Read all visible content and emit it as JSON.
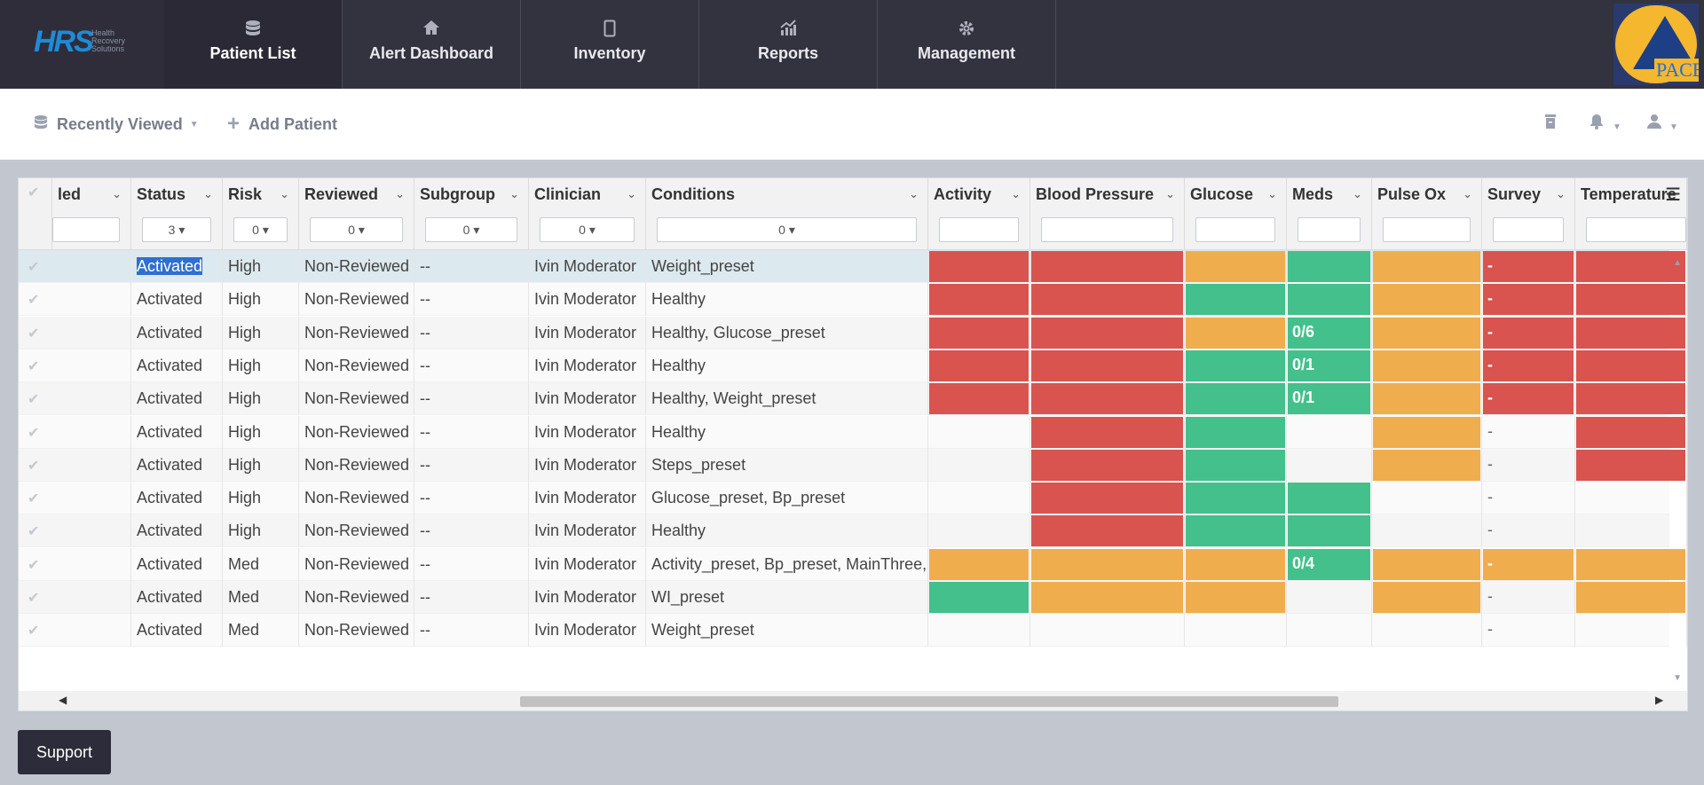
{
  "brand": {
    "logo_text": "HRS",
    "logo_sub": "Health Recovery Solutions",
    "corner_logo_text": "PACE"
  },
  "nav": [
    {
      "label": "Patient List",
      "icon": "database-icon",
      "active": true
    },
    {
      "label": "Alert Dashboard",
      "icon": "home-icon",
      "active": false
    },
    {
      "label": "Inventory",
      "icon": "tablet-icon",
      "active": false
    },
    {
      "label": "Reports",
      "icon": "chart-icon",
      "active": false
    },
    {
      "label": "Management",
      "icon": "gear-icon",
      "active": false
    }
  ],
  "toolbar": {
    "recently_viewed": "Recently Viewed",
    "add_patient": "Add Patient"
  },
  "grid": {
    "columns": [
      {
        "label": "led",
        "filter": ""
      },
      {
        "label": "Status",
        "filter": "3"
      },
      {
        "label": "Risk",
        "filter": "0"
      },
      {
        "label": "Reviewed",
        "filter": "0"
      },
      {
        "label": "Subgroup",
        "filter": "0"
      },
      {
        "label": "Clinician",
        "filter": "0"
      },
      {
        "label": "Conditions",
        "filter": "0"
      },
      {
        "label": "Activity",
        "filter": ""
      },
      {
        "label": "Blood Pressure",
        "filter": ""
      },
      {
        "label": "Glucose",
        "filter": ""
      },
      {
        "label": "Meds",
        "filter": ""
      },
      {
        "label": "Pulse Ox",
        "filter": ""
      },
      {
        "label": "Survey",
        "filter": ""
      },
      {
        "label": "Temperature",
        "filter": ""
      }
    ],
    "rows": [
      {
        "status": "Activated",
        "risk": "High",
        "reviewed": "Non-Reviewed",
        "subgroup": "--",
        "clinician": "Ivin Moderator",
        "conditions": "Weight_preset",
        "activity": "red",
        "bp": "red",
        "glucose": "orange",
        "meds": "green",
        "meds_text": "",
        "pulse": "orange",
        "survey": "red",
        "survey_text": "-",
        "temp": "red"
      },
      {
        "status": "Activated",
        "risk": "High",
        "reviewed": "Non-Reviewed",
        "subgroup": "--",
        "clinician": "Ivin Moderator",
        "conditions": "Healthy",
        "activity": "red",
        "bp": "red",
        "glucose": "green",
        "meds": "green",
        "meds_text": "",
        "pulse": "orange",
        "survey": "red",
        "survey_text": "-",
        "temp": "red"
      },
      {
        "status": "Activated",
        "risk": "High",
        "reviewed": "Non-Reviewed",
        "subgroup": "--",
        "clinician": "Ivin Moderator",
        "conditions": "Healthy, Glucose_preset",
        "activity": "red",
        "bp": "red",
        "glucose": "orange",
        "meds": "green",
        "meds_text": "0/6",
        "pulse": "orange",
        "survey": "red",
        "survey_text": "-",
        "temp": "red"
      },
      {
        "status": "Activated",
        "risk": "High",
        "reviewed": "Non-Reviewed",
        "subgroup": "--",
        "clinician": "Ivin Moderator",
        "conditions": "Healthy",
        "activity": "red",
        "bp": "red",
        "glucose": "green",
        "meds": "green",
        "meds_text": "0/1",
        "pulse": "orange",
        "survey": "red",
        "survey_text": "-",
        "temp": "red"
      },
      {
        "status": "Activated",
        "risk": "High",
        "reviewed": "Non-Reviewed",
        "subgroup": "--",
        "clinician": "Ivin Moderator",
        "conditions": "Healthy, Weight_preset",
        "activity": "red",
        "bp": "red",
        "glucose": "green",
        "meds": "green",
        "meds_text": "0/1",
        "pulse": "orange",
        "survey": "red",
        "survey_text": "-",
        "temp": "red"
      },
      {
        "status": "Activated",
        "risk": "High",
        "reviewed": "Non-Reviewed",
        "subgroup": "--",
        "clinician": "Ivin Moderator",
        "conditions": "Healthy",
        "activity": "",
        "bp": "red",
        "glucose": "green",
        "meds": "",
        "meds_text": "",
        "pulse": "orange",
        "survey": "",
        "survey_text": "-",
        "temp": "red"
      },
      {
        "status": "Activated",
        "risk": "High",
        "reviewed": "Non-Reviewed",
        "subgroup": "--",
        "clinician": "Ivin Moderator",
        "conditions": "Steps_preset",
        "activity": "",
        "bp": "red",
        "glucose": "green",
        "meds": "",
        "meds_text": "",
        "pulse": "orange",
        "survey": "",
        "survey_text": "-",
        "temp": "red"
      },
      {
        "status": "Activated",
        "risk": "High",
        "reviewed": "Non-Reviewed",
        "subgroup": "--",
        "clinician": "Ivin Moderator",
        "conditions": "Glucose_preset, Bp_preset",
        "activity": "",
        "bp": "red",
        "glucose": "green",
        "meds": "green",
        "meds_text": "",
        "pulse": "",
        "survey": "",
        "survey_text": "-",
        "temp": ""
      },
      {
        "status": "Activated",
        "risk": "High",
        "reviewed": "Non-Reviewed",
        "subgroup": "--",
        "clinician": "Ivin Moderator",
        "conditions": "Healthy",
        "activity": "",
        "bp": "red",
        "glucose": "green",
        "meds": "green",
        "meds_text": "",
        "pulse": "",
        "survey": "",
        "survey_text": "-",
        "temp": ""
      },
      {
        "status": "Activated",
        "risk": "Med",
        "reviewed": "Non-Reviewed",
        "subgroup": "--",
        "clinician": "Ivin Moderator",
        "conditions": "Activity_preset, Bp_preset, MainThree,",
        "activity": "orange",
        "bp": "orange",
        "glucose": "orange",
        "meds": "green",
        "meds_text": "0/4",
        "pulse": "orange",
        "survey": "orange",
        "survey_text": "-",
        "temp": "orange"
      },
      {
        "status": "Activated",
        "risk": "Med",
        "reviewed": "Non-Reviewed",
        "subgroup": "--",
        "clinician": "Ivin Moderator",
        "conditions": "WI_preset",
        "activity": "green",
        "bp": "orange",
        "glucose": "orange",
        "meds": "",
        "meds_text": "",
        "pulse": "orange",
        "survey": "",
        "survey_text": "-",
        "temp": "orange"
      },
      {
        "status": "Activated",
        "risk": "Med",
        "reviewed": "Non-Reviewed",
        "subgroup": "--",
        "clinician": "Ivin Moderator",
        "conditions": "Weight_preset",
        "activity": "",
        "bp": "",
        "glucose": "",
        "meds": "",
        "meds_text": "",
        "pulse": "",
        "survey": "",
        "survey_text": "-",
        "temp": ""
      }
    ]
  },
  "support_label": "Support",
  "colors": {
    "red": "#d9534f",
    "orange": "#f0ad4e",
    "green": "#43c08b",
    "nav_bg": "#33323f"
  }
}
